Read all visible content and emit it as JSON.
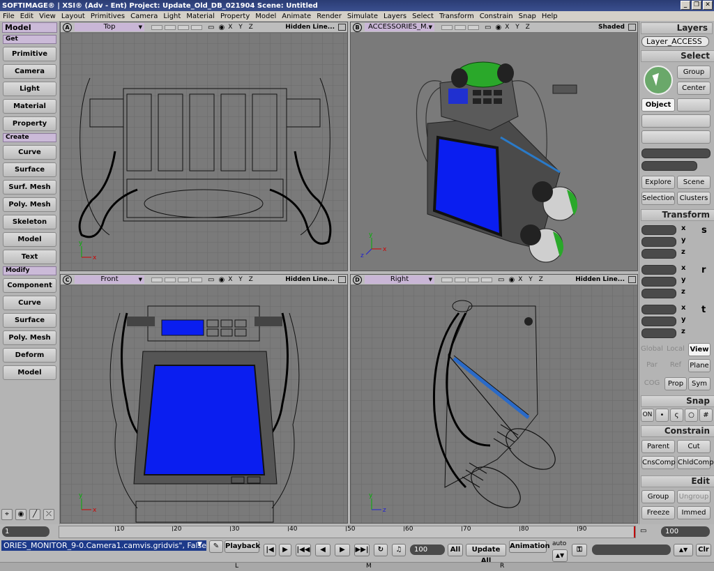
{
  "titlebar": {
    "title": "SOFTIMAGE® | XSI® (Adv - Ent) Project: Update_Old_DB_021904    Scene: Untitled",
    "minimize": "_",
    "restore": "❐",
    "close": "✕"
  },
  "menu": [
    "File",
    "Edit",
    "View",
    "Layout",
    "Primitives",
    "Camera",
    "Light",
    "Material",
    "Property",
    "Model",
    "Animate",
    "Render",
    "Simulate",
    "Layers",
    "Select",
    "Transform",
    "Constrain",
    "Snap",
    "Help"
  ],
  "left": {
    "title": "Model",
    "get": {
      "label": "Get",
      "items": [
        "Primitive",
        "Camera",
        "Light",
        "Material",
        "Property"
      ]
    },
    "create": {
      "label": "Create",
      "items": [
        "Curve",
        "Surface",
        "Surf. Mesh",
        "Poly. Mesh",
        "Skeleton",
        "Model",
        "Text"
      ]
    },
    "modify": {
      "label": "Modify",
      "items": [
        "Component",
        "Curve",
        "Surface",
        "Poly. Mesh",
        "Deform",
        "Model"
      ]
    },
    "bottom_icons": [
      "select-tool-icon",
      "paint-tool-icon",
      "brush-tool-icon",
      "tweak-tool-icon"
    ]
  },
  "viewports": {
    "a": {
      "letter": "A",
      "name": "Top",
      "mode": "Hidden Line..."
    },
    "b": {
      "letter": "B",
      "name": "ACCESSORIES_M..",
      "mode": "Shaded"
    },
    "c": {
      "letter": "C",
      "name": "Front",
      "mode": "Hidden Line..."
    },
    "d": {
      "letter": "D",
      "name": "Right",
      "mode": "Hidden Line..."
    },
    "xyz": "X Y Z",
    "axis": {
      "x": "x",
      "y": "y",
      "z": "z"
    }
  },
  "right": {
    "layers_title": "Layers",
    "layer_name": "Layer_ACCESS",
    "select_title": "Select",
    "group": "Group",
    "center": "Center",
    "object": "Object",
    "explore": "Explore",
    "scene": "Scene",
    "selection": "Selection",
    "clusters": "Clusters",
    "transform_title": "Transform",
    "axes": [
      "x",
      "y",
      "z"
    ],
    "srt": [
      "s",
      "r",
      "t"
    ],
    "global": "Global",
    "local": "Local",
    "view": "View",
    "par": "Par",
    "ref": "Ref",
    "plane": "Plane",
    "cog": "COG",
    "prop": "Prop",
    "sym": "Sym",
    "snap_title": "Snap",
    "snap_on": "ON",
    "constrain_title": "Constrain",
    "parent": "Parent",
    "cut": "Cut",
    "cnscomp": "CnsComp",
    "chldcomp": "ChldComp",
    "edit_title": "Edit",
    "group2": "Group",
    "ungroup": "Ungroup",
    "freeze": "Freeze",
    "immed": "Immed"
  },
  "timeline": {
    "start": "1",
    "end": "100",
    "ticks": [
      "10",
      "20",
      "30",
      "40",
      "50",
      "60",
      "70",
      "80",
      "90"
    ]
  },
  "status": {
    "command": "ORIES_MONITOR_9-0.Camera1.camvis.gridvis\", False",
    "playback": "Playback",
    "frame": "100",
    "all": "All",
    "update_all": "Update All",
    "animation": "Animation",
    "auto": "auto",
    "clr": "Clr",
    "mouse_l": "L",
    "mouse_m": "M",
    "mouse_r": "R"
  }
}
